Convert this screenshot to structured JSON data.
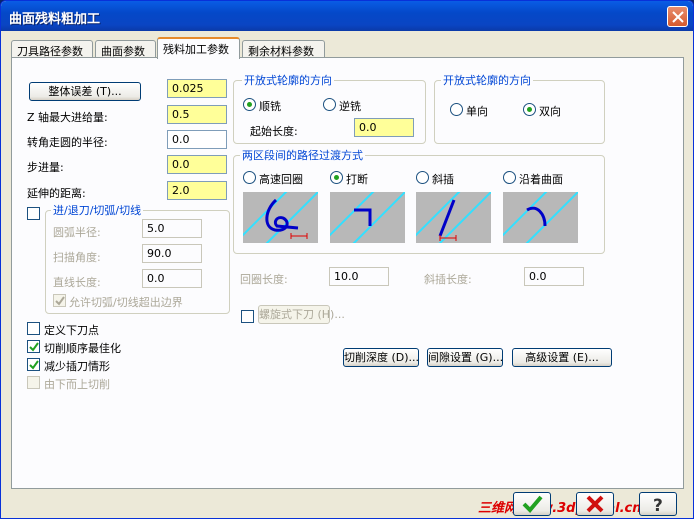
{
  "window": {
    "title": "曲面残料粗加工"
  },
  "tabs": [
    "刀具路径参数",
    "曲面参数",
    "残料加工参数",
    "剩余材料参数"
  ],
  "left": {
    "overall_error_button": "整体误差 (T)...",
    "overall_error_value": "0.025",
    "z_max_step_label": "Z 轴最大进给量:",
    "z_max_step_value": "0.5",
    "corner_radius_label": "转角走圆的半径:",
    "corner_radius_value": "0.0",
    "stepover_label": "步进量:",
    "stepover_value": "0.0",
    "extension_label": "延伸的距离:",
    "extension_value": "2.0",
    "lead_group_label": "进/退刀/切弧/切线",
    "arc_radius_label": "圆弧半径:",
    "arc_radius_value": "5.0",
    "sweep_angle_label": "扫描角度:",
    "sweep_angle_value": "90.0",
    "line_length_label": "直线长度:",
    "line_length_value": "0.0",
    "allow_over_boundary_label": "允许切弧/切线超出边界",
    "define_plunge_label": "定义下刀点",
    "optimize_order_label": "切削顺序最佳化",
    "reduce_plunge_label": "减少插刀情形",
    "bottom_up_label": "由下而上切削"
  },
  "open_contour_1": {
    "title": "开放式轮廓的方向",
    "climb_label": "顺铣",
    "conventional_label": "逆铣",
    "start_length_label": "起始长度:",
    "start_length_value": "0.0"
  },
  "open_contour_2": {
    "title": "开放式轮廓的方向",
    "one_way_label": "单向",
    "two_way_label": "双向"
  },
  "transition": {
    "title": "两区段间的路径过渡方式",
    "high_speed_loop_label": "高速回圈",
    "break_label": "打断",
    "ramp_label": "斜插",
    "follow_surface_label": "沿着曲面",
    "loop_length_label": "回圈长度:",
    "loop_length_value": "10.0",
    "ramp_length_label": "斜插长度:",
    "ramp_length_value": "0.0"
  },
  "helix_button": "螺旋式下刀 (H)...",
  "depth_button": "切削深度 (D)...",
  "gap_button": "间隙设置 (G)...",
  "advanced_button": "高级设置 (E)...",
  "watermark": "三维网www.3dportal.cn",
  "colors": {
    "accent": "#0046d5",
    "highlight_field": "#ffff99",
    "preview_line": "#0000c8"
  }
}
